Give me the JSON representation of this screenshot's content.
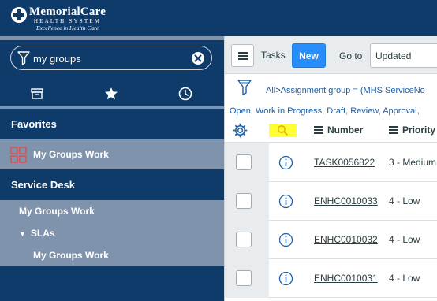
{
  "brand": {
    "name": "MemorialCare",
    "subtitle": "HEALTH SYSTEM",
    "tagline": "Excellence in Health Care"
  },
  "navigator": {
    "filter_value": "my groups",
    "favorites_header": "Favorites",
    "favorites": [
      {
        "label": "My Groups Work",
        "icon": "grid-icon"
      }
    ],
    "module_header": "Service Desk",
    "modules": [
      {
        "label": "My Groups Work"
      },
      {
        "label": "SLAs",
        "expanded": true
      },
      {
        "label": "My Groups Work"
      }
    ]
  },
  "toolbar": {
    "title": "Tasks",
    "new_label": "New",
    "goto_label": "Go to",
    "goto_value": "Updated"
  },
  "breadcrumb": {
    "all_label": "All",
    "separator": ">",
    "condition": "Assignment group = (MHS ServiceNo",
    "states": "Open, Work in Progress, Draft, Review, Approval,"
  },
  "table": {
    "columns": [
      "Number",
      "Priority"
    ],
    "rows": [
      {
        "number": "TASK0056822",
        "priority": "3 - Medium"
      },
      {
        "number": "ENHC0010033",
        "priority": "4 - Low"
      },
      {
        "number": "ENHC0010032",
        "priority": "4 - Low"
      },
      {
        "number": "ENHC0010031",
        "priority": "4 - Low"
      }
    ]
  },
  "colors": {
    "nav_background": "#0f3b6b",
    "nav_selected": "#7f93ad",
    "new_button": "#278efc",
    "search_highlight": "#ffff33",
    "link": "#1b5fa8"
  }
}
